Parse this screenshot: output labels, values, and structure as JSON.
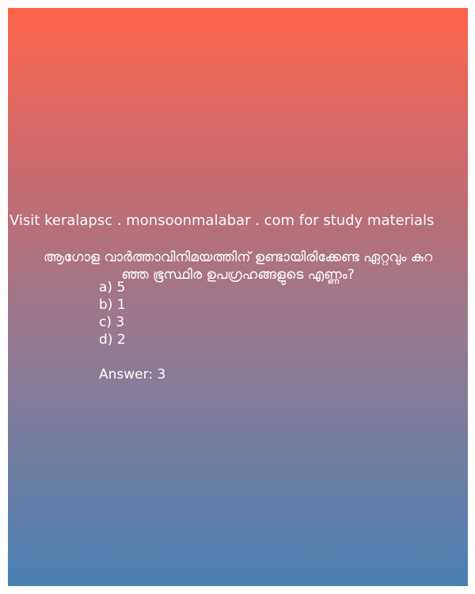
{
  "promo_text": "Visit keralapsc . monsoonmalabar . com for study materials",
  "question": {
    "line1": "ആഗോള വാർത്താവിനിമയത്തിന് ഉണ്ടായിരിക്കേണ്ട ഏറ്റവും കുറ",
    "line2": "ഞ്ഞ ഭൂസ്ഥിര ഉപഗ്രഹങ്ങളുടെ എണ്ണം?"
  },
  "options": [
    "a) 5",
    "b) 1",
    "c) 3",
    "d) 2"
  ],
  "answer": "Answer: 3",
  "colors": {
    "gradient_top": "#ff644b",
    "gradient_bottom": "#4a80b3",
    "text": "#ffffff"
  }
}
